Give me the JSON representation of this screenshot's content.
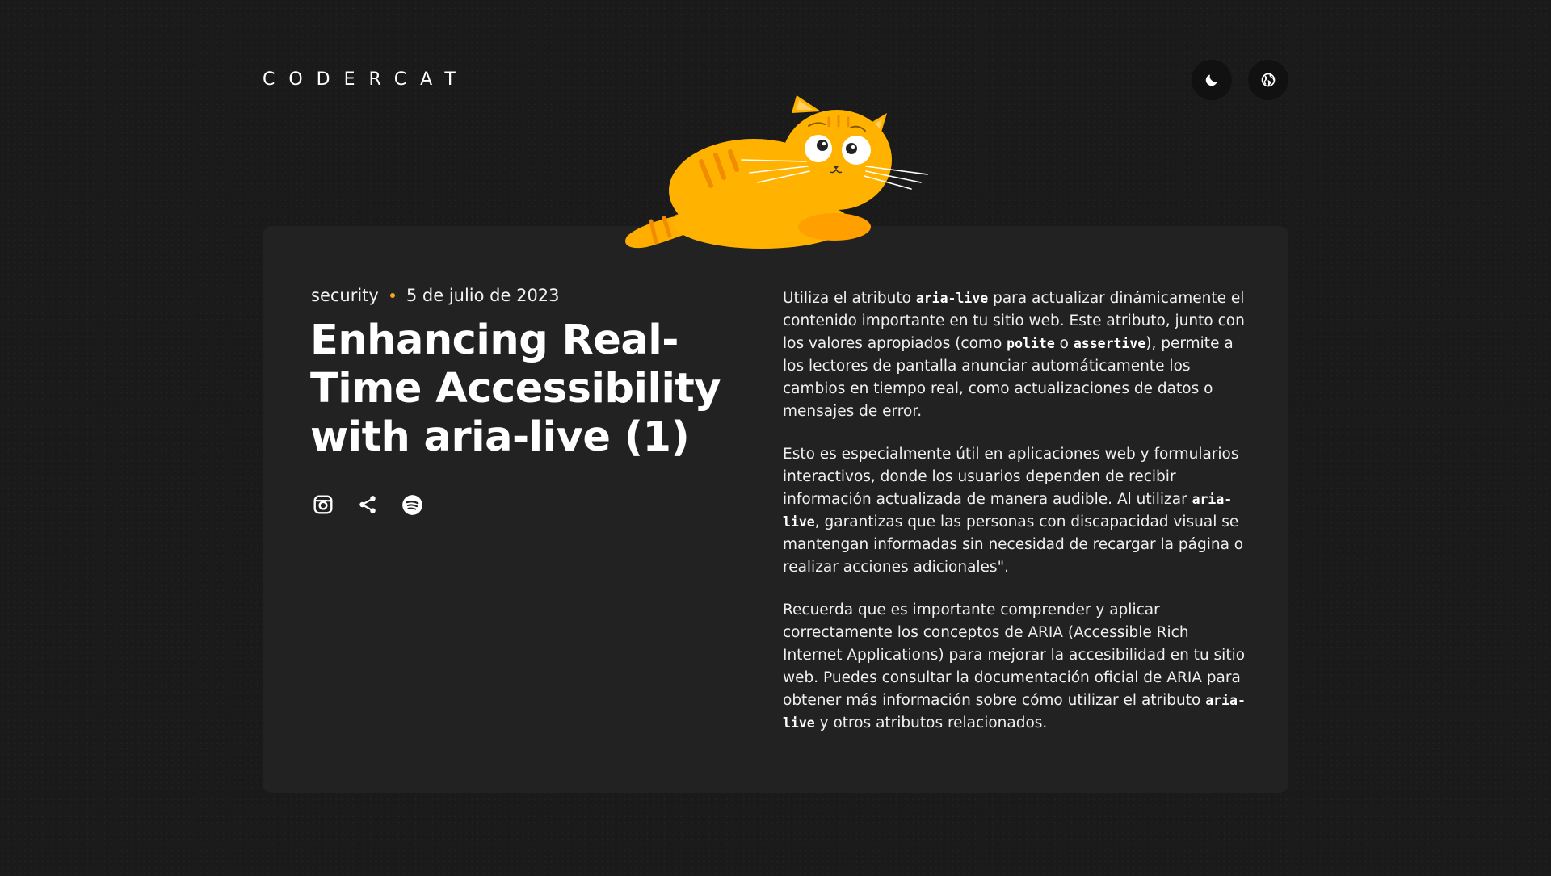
{
  "header": {
    "logo": "CODERCAT",
    "theme_icon": "moon-icon",
    "lang_icon": "globe-icon"
  },
  "illustration": {
    "icon": "orange-cat-illustration"
  },
  "post": {
    "category": "security",
    "date": "5 de julio de 2023",
    "title": "Enhancing Real-Time Accessibility with aria-live (1)",
    "share": {
      "instagram_icon": "instagram-icon",
      "share_icon": "share-icon",
      "spotify_icon": "spotify-icon"
    },
    "paragraphs": [
      {
        "p1": "Utiliza el atributo ",
        "c1": "aria-live",
        "p2": " para actualizar dinámicamente el contenido importante en tu sitio web. Este atributo, junto con los valores apropiados (como ",
        "c2": "polite",
        "p3": " o ",
        "c3": "assertive",
        "p4": "), permite a los lectores de pantalla anunciar automáticamente los cambios en tiempo real, como actualizaciones de datos o mensajes de error."
      },
      {
        "p1": "Esto es especialmente útil en aplicaciones web y formularios interactivos, donde los usuarios dependen de recibir información actualizada de manera audible. Al utilizar ",
        "c1": "aria-live",
        "p2": ", garantizas que las personas con discapacidad visual se mantengan informadas sin necesidad de recargar la página o realizar acciones adicionales\"."
      },
      {
        "p1": "Recuerda que es importante comprender y aplicar correctamente los conceptos de ARIA (Accessible Rich Internet Applications) para mejorar la accesibilidad en tu sitio web. Puedes consultar la documentación oficial de ARIA para obtener más información sobre cómo utilizar el atributo ",
        "c1": "aria-live",
        "p2": " y otros atributos relacionados."
      }
    ]
  },
  "colors": {
    "background": "#1a1a1a",
    "card": "#222222",
    "accent": "#f5a623",
    "cat_orange": "#ffb000"
  }
}
